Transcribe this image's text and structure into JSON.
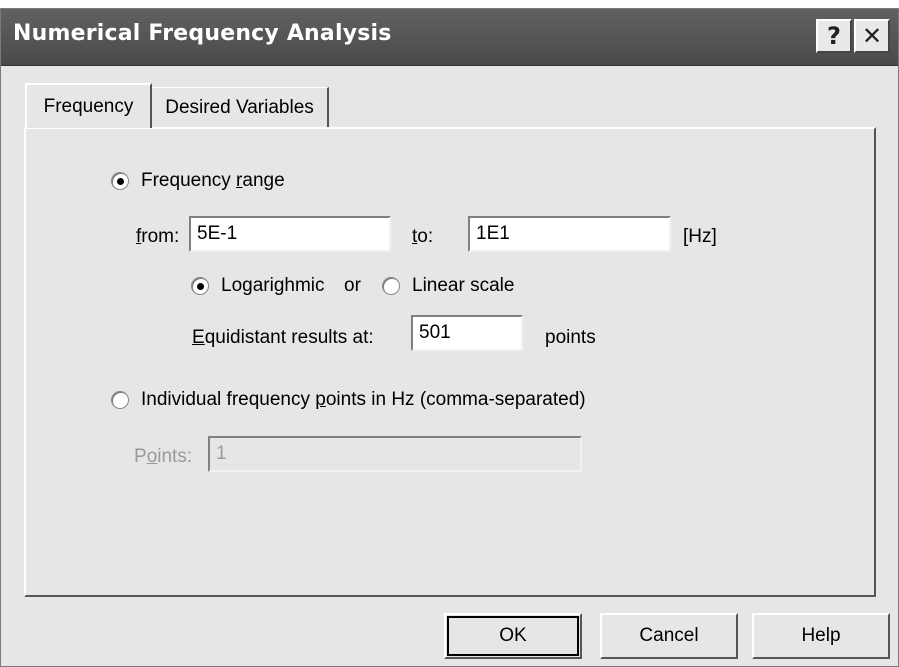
{
  "window": {
    "title": "Numerical Frequency Analysis",
    "help_glyph": "?",
    "close_glyph": "✕"
  },
  "tabs": [
    {
      "label": "Frequency",
      "active": true
    },
    {
      "label": "Desired Variables",
      "active": false
    }
  ],
  "frequency": {
    "range_option": {
      "pre": "Frequency ",
      "ul": "r",
      "post": "ange",
      "selected": true
    },
    "from": {
      "ul": "f",
      "post": "rom:",
      "value": "5E-1"
    },
    "to": {
      "ul": "t",
      "post": "o:",
      "value": "1E1"
    },
    "unit": "[Hz]",
    "scale": {
      "log_label": "Logarighmic",
      "log_selected": true,
      "or_label": "or",
      "linear_label": "Linear scale",
      "linear_selected": false
    },
    "equidistant": {
      "ul": "E",
      "post": "quidistant results at:",
      "value": "501",
      "suffix": "points"
    },
    "individual_option": {
      "pre": "Individual frequency ",
      "ul": "p",
      "post": "oints in Hz (comma-separated)",
      "selected": false
    },
    "points": {
      "pre": "P",
      "ul": "o",
      "post": "ints:",
      "value": "1",
      "disabled": true
    }
  },
  "buttons": {
    "ok": "OK",
    "cancel": "Cancel",
    "help": "Help"
  }
}
